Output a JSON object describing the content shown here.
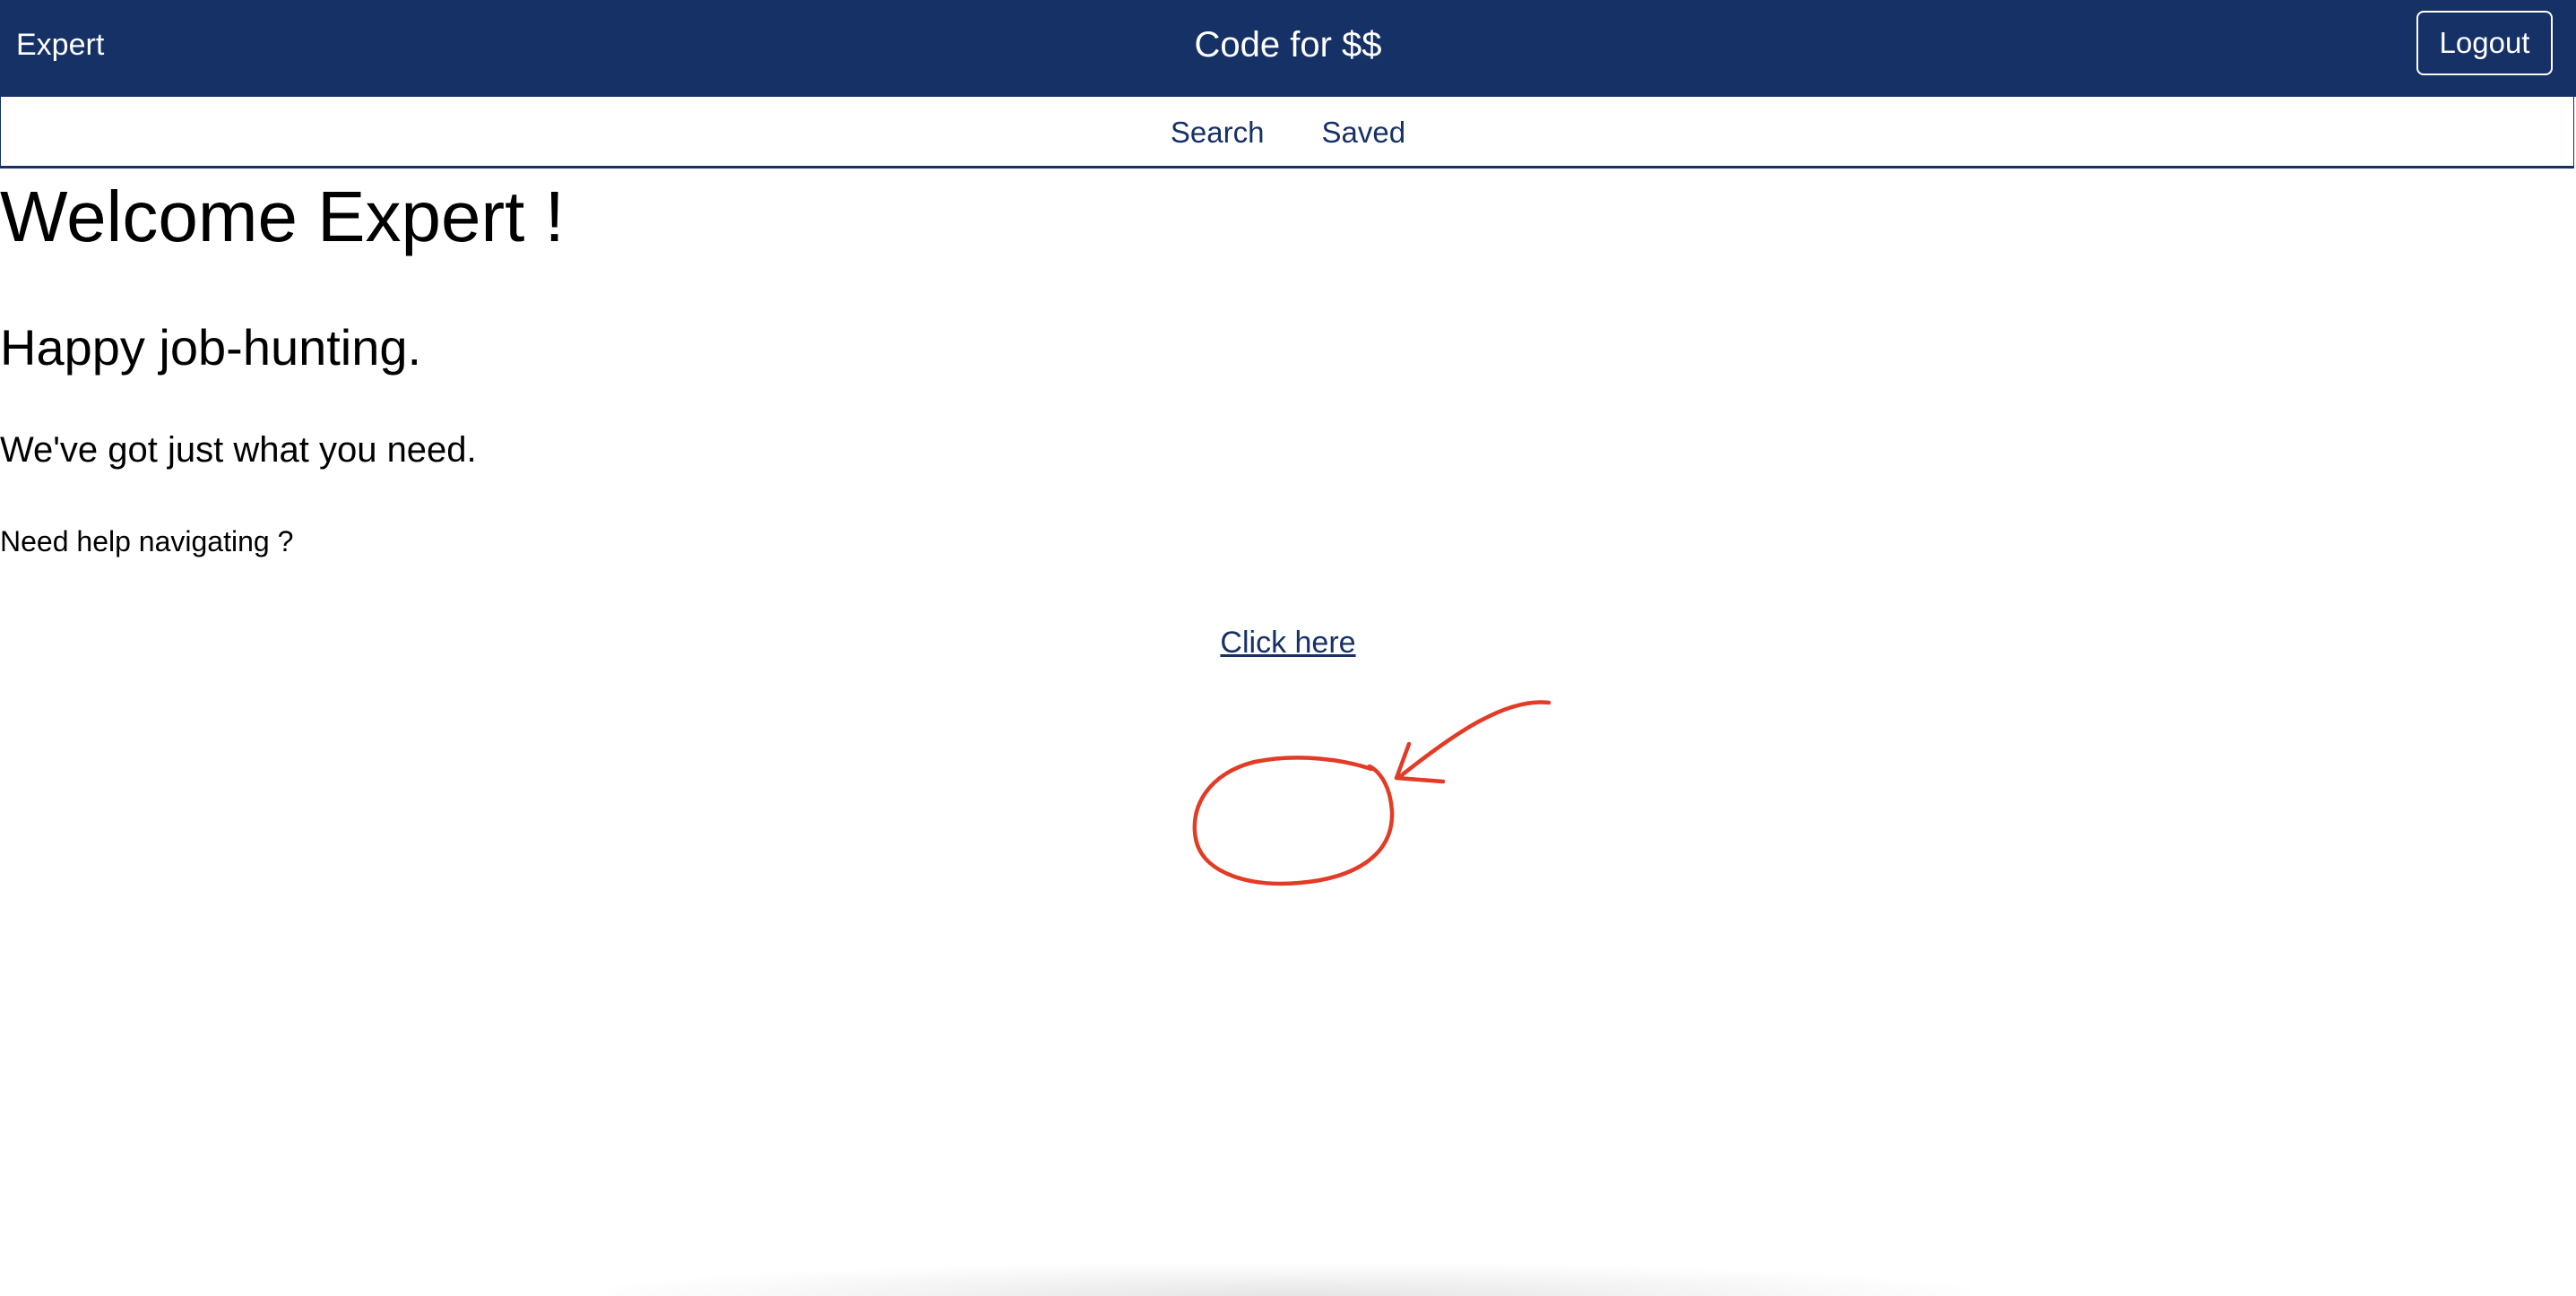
{
  "header": {
    "brand": "Expert",
    "title": "Code for $$",
    "logout_label": "Logout"
  },
  "nav": {
    "items": [
      {
        "label": "Search"
      },
      {
        "label": "Saved"
      }
    ]
  },
  "main": {
    "welcome": "Welcome Expert !",
    "tagline": "Happy job-hunting.",
    "subtagline": "We've got just what you need.",
    "help_prompt": "Need help navigating ?",
    "help_link": "Click here"
  },
  "colors": {
    "primary": "#163166",
    "text": "#212529",
    "annotation": "#e23b26"
  }
}
